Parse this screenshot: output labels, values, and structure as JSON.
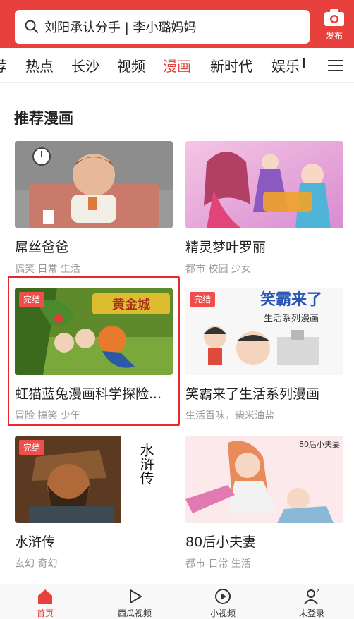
{
  "header": {
    "search_text": "刘阳承认分手 | 李小璐妈妈",
    "publish_label": "发布",
    "icons": [
      "search-icon",
      "camera-icon"
    ],
    "color": "#e8403c"
  },
  "tabs": {
    "items": [
      "荐",
      "热点",
      "长沙",
      "视频",
      "漫画",
      "新时代",
      "娱乐",
      "I"
    ],
    "active": "漫画",
    "menu_icon": "hamburger-menu-icon"
  },
  "section": {
    "title": "推荐漫画"
  },
  "cards": [
    {
      "title": "屌丝爸爸",
      "tags": "搞笑 日常 生活",
      "badge": ""
    },
    {
      "title": "精灵梦叶罗丽",
      "tags": "都市 校园 少女",
      "badge": ""
    },
    {
      "title": "虹猫蓝兔漫画科学探险...",
      "tags": "冒险 搞笑 少年",
      "badge": "完结",
      "thumb_text": "黄金城"
    },
    {
      "title": "笑霸来了生活系列漫画",
      "tags": "生活百味，柴米油盐",
      "badge": "完结",
      "thumb_text": "笑霸来了",
      "thumb_sub": "生活系列漫画"
    },
    {
      "title": "水浒传",
      "tags": "玄幻 奇幻",
      "badge": "完结",
      "thumb_text": "水浒传"
    },
    {
      "title": "80后小夫妻",
      "tags": "都市 日常 生活",
      "badge": "",
      "thumb_text": "80后小夫妻"
    }
  ],
  "bottom_nav": {
    "items": [
      {
        "label": "首页",
        "icon": "home-icon"
      },
      {
        "label": "西瓜视频",
        "icon": "play-icon"
      },
      {
        "label": "小视频",
        "icon": "short-video-icon"
      },
      {
        "label": "未登录",
        "icon": "user-icon"
      }
    ],
    "active": "首页"
  }
}
